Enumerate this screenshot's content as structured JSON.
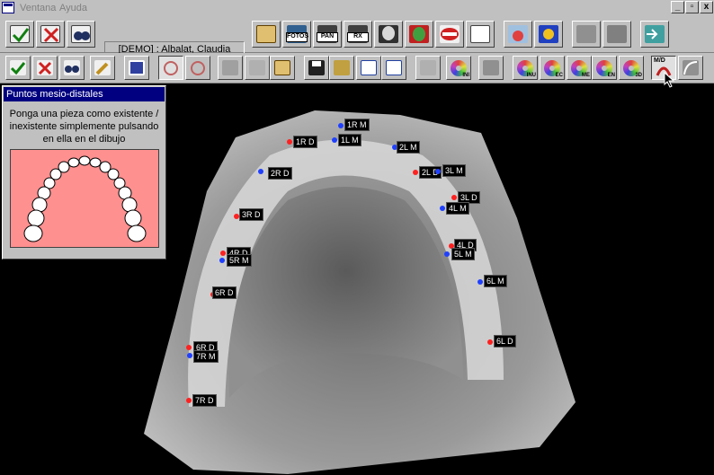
{
  "menu": {
    "items": [
      "Ventana",
      "Ayuda"
    ],
    "window_buttons": [
      "_",
      "▫",
      "x"
    ]
  },
  "toolbar1": {
    "patient_label": "[DEMO] : Albalat, Claudia",
    "buttons": [
      {
        "name": "accept-patient-button",
        "icon": "check-form-icon"
      },
      {
        "name": "delete-patient-button",
        "icon": "delete-form-icon"
      },
      {
        "name": "search-patient-button",
        "icon": "binoculars-form-icon"
      },
      {
        "name": "patient-card-button",
        "icon": "id-card-icon"
      },
      {
        "name": "photos-button",
        "icon": "film-icon",
        "label": "FOTOS"
      },
      {
        "name": "pan-button",
        "icon": "xray-pan-icon",
        "label": "PAN"
      },
      {
        "name": "rx-button",
        "icon": "xray-rx-icon",
        "label": "RX"
      },
      {
        "name": "skull-button",
        "icon": "skull-icon"
      },
      {
        "name": "2d-button",
        "icon": "2d-face-icon",
        "label": "2D"
      },
      {
        "name": "mouth-button",
        "icon": "mouth-icon"
      },
      {
        "name": "document-button",
        "icon": "document-icon"
      },
      {
        "name": "network-button",
        "icon": "network-icon"
      },
      {
        "name": "settings-button",
        "icon": "settings-gear-icon"
      },
      {
        "name": "printer-button",
        "icon": "printer-icon"
      },
      {
        "name": "scanner-button",
        "icon": "scanner-icon"
      },
      {
        "name": "exit-button",
        "icon": "exit-door-icon"
      }
    ]
  },
  "toolbar2": {
    "buttons": [
      {
        "name": "accept-2d-button",
        "icon": "check-2d-icon"
      },
      {
        "name": "delete-2d-button",
        "icon": "delete-2d-icon"
      },
      {
        "name": "find-2d-button",
        "icon": "binoculars-2d-icon"
      },
      {
        "name": "edit-button",
        "icon": "pencil-edit-icon"
      },
      {
        "name": "frame-button",
        "icon": "frame-icon"
      },
      {
        "name": "ring-left-button",
        "icon": "ring-icon"
      },
      {
        "name": "ring-right-button",
        "icon": "ring-icon"
      },
      {
        "name": "camera-button",
        "icon": "camera-icon"
      },
      {
        "name": "import-button",
        "icon": "import-image-icon"
      },
      {
        "name": "portrait-button",
        "icon": "portrait-icon"
      },
      {
        "name": "save-button",
        "icon": "floppy-disk-icon"
      },
      {
        "name": "open-button",
        "icon": "folder-open-icon"
      },
      {
        "name": "word-export-button",
        "icon": "word-doc-icon"
      },
      {
        "name": "word-report-button",
        "icon": "word-report-icon"
      },
      {
        "name": "zoom-button",
        "icon": "magnifier-icon"
      },
      {
        "name": "ini-button",
        "icon": "cd-disc-icon",
        "label": "INI"
      },
      {
        "name": "play-button",
        "icon": "play-icon"
      },
      {
        "name": "inu-button",
        "icon": "cd-disc-icon",
        "label": "INU"
      },
      {
        "name": "ec-button",
        "icon": "cd-disc-icon",
        "label": "EC"
      },
      {
        "name": "me-button",
        "icon": "cd-disc-icon",
        "label": "ME"
      },
      {
        "name": "en-button",
        "icon": "cd-disc-icon",
        "label": "EN"
      },
      {
        "name": "3d-button",
        "icon": "cd-disc-icon",
        "label": "3D"
      },
      {
        "name": "md-points-button",
        "icon": "mesio-distal-icon",
        "label": "M/D"
      },
      {
        "name": "curve-button",
        "icon": "curve-icon"
      }
    ]
  },
  "panel": {
    "title": "Puntos mesio-distales",
    "instructions": "Ponga una pieza como existente / inexistente simplemente pulsando en ella en el dibujo"
  },
  "markers": [
    {
      "text": "1R M"
    },
    {
      "text": "1L M"
    },
    {
      "text": "1R D"
    },
    {
      "text": "2L M"
    },
    {
      "text": "2R D"
    },
    {
      "text": "2L D"
    },
    {
      "text": "3L M"
    },
    {
      "text": "3L D"
    },
    {
      "text": "4L M"
    },
    {
      "text": "3R D"
    },
    {
      "text": "4L D"
    },
    {
      "text": "5L M"
    },
    {
      "text": "4R D"
    },
    {
      "text": "5R M"
    },
    {
      "text": "6L M"
    },
    {
      "text": "6R D"
    },
    {
      "text": "6L D"
    },
    {
      "text": "6R D"
    },
    {
      "text": "7R M"
    },
    {
      "text": "7R D"
    }
  ],
  "colors": {
    "mesial": "#2040ff",
    "distal": "#ff2020",
    "panel_image_bg": "#ff9090",
    "title_bar": "#000080"
  }
}
